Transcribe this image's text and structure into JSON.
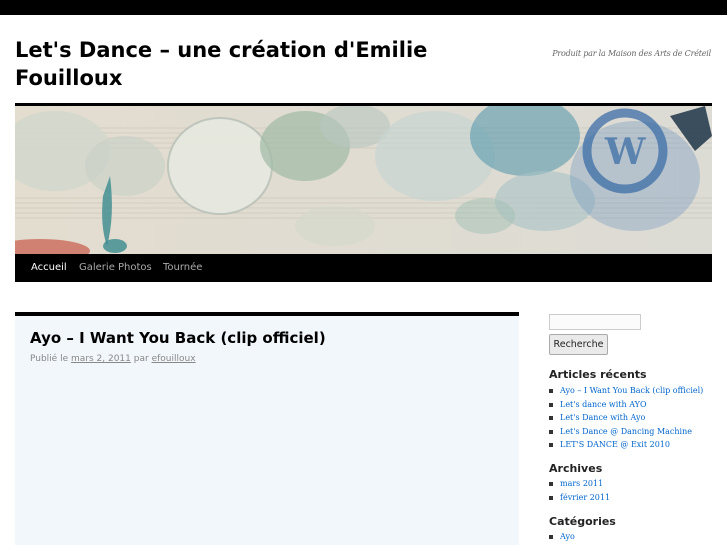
{
  "site": {
    "title": "Let's Dance – une création d'Emilie Fouilloux",
    "description": "Produit par la Maison des Arts de Créteil"
  },
  "nav": {
    "items": [
      {
        "label": "Accueil",
        "active": true
      },
      {
        "label": "Galerie Photos",
        "active": false
      },
      {
        "label": "Tournée",
        "active": false
      }
    ]
  },
  "post": {
    "title": "Ayo – I Want You Back (clip officiel)",
    "meta_prefix": "Publié le",
    "date": "mars 2, 2011",
    "meta_by": "par",
    "author": "efouilloux"
  },
  "sidebar": {
    "search": {
      "button_label": "Recherche",
      "value": ""
    },
    "recent": {
      "title": "Articles récents",
      "items": [
        "Ayo – I Want You Back (clip officiel)",
        "Let's dance with AYO",
        "Let's Dance with Ayo",
        "Let's Dance @ Dancing Machine",
        "LET'S DANCE @ Exit 2010"
      ]
    },
    "archives": {
      "title": "Archives",
      "items": [
        "mars 2011",
        "février 2011"
      ]
    },
    "categories": {
      "title": "Catégories",
      "items": [
        "Ayo"
      ]
    }
  },
  "colors": {
    "link": "#0066cc",
    "bar": "#000000",
    "post_bg": "#f2f7fc"
  }
}
